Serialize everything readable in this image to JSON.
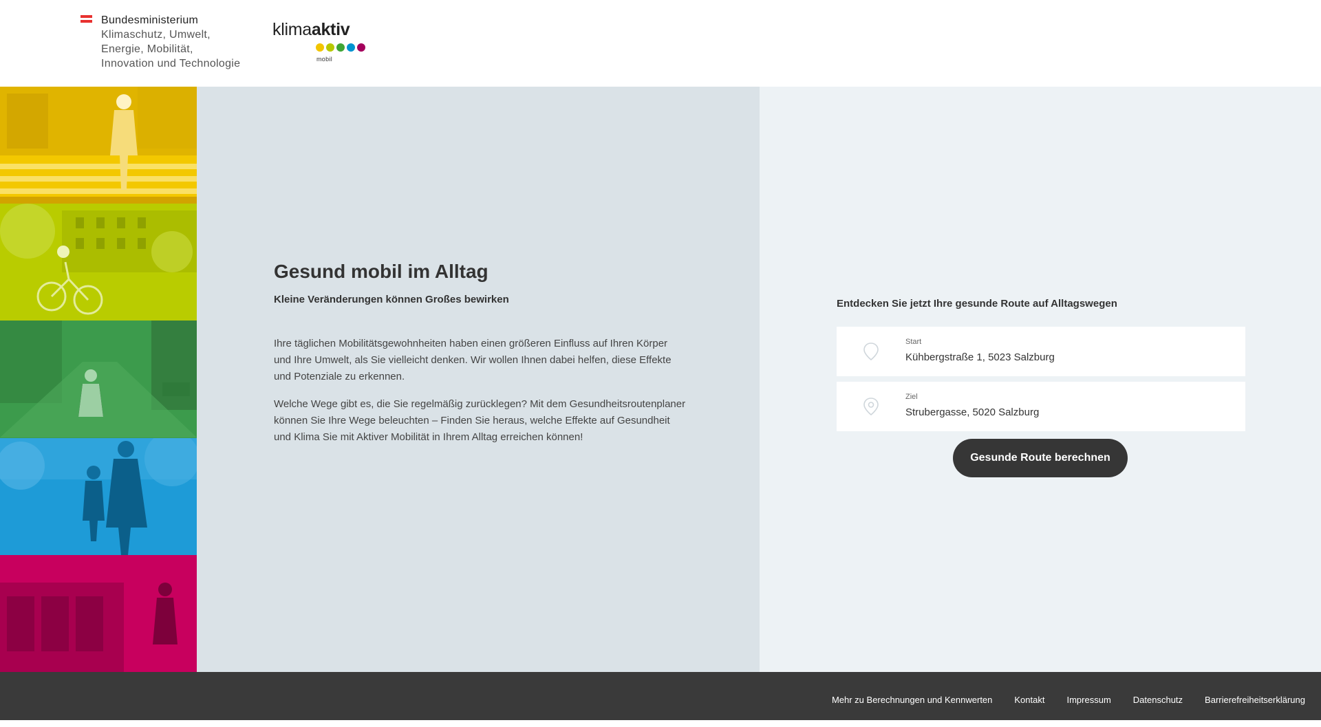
{
  "header": {
    "ministry_lines": [
      "Bundesministerium",
      "Klimaschutz, Umwelt,",
      "Energie, Mobilität,",
      "Innovation und Technologie"
    ],
    "klima_logo": {
      "word_regular": "klima",
      "word_bold": "aktiv",
      "sub": "mobil",
      "dot_colors": [
        "#f2c500",
        "#b7c800",
        "#3fa535",
        "#0093d0",
        "#a4005c"
      ]
    },
    "flag_colors": [
      "#e8312f",
      "#ffffff",
      "#e8312f"
    ]
  },
  "photo_strip": {
    "tiles": [
      {
        "name": "pedestrian-crossing-photo",
        "color": "#f3c800"
      },
      {
        "name": "cyclist-photo",
        "color": "#b9cc00"
      },
      {
        "name": "street-walker-photo",
        "color": "#3c9b4c"
      },
      {
        "name": "family-walking-photo",
        "color": "#1e9bd7"
      },
      {
        "name": "bus-passenger-photo",
        "color": "#c8005e"
      }
    ]
  },
  "intro": {
    "title": "Gesund mobil im Alltag",
    "subtitle": "Kleine Veränderungen können Großes bewirken",
    "paragraphs": [
      "Ihre täglichen Mobilitätsgewohnheiten haben einen größeren Einfluss auf Ihren Körper und Ihre Umwelt, als Sie vielleicht denken. Wir wollen Ihnen dabei helfen, diese Effekte und Potenziale zu erkennen.",
      "Welche Wege gibt es, die Sie regelmäßig zurücklegen? Mit dem Gesundheitsroutenplaner können Sie Ihre Wege beleuchten – Finden Sie heraus, welche Effekte auf Gesundheit und Klima Sie mit Aktiver Mobilität in Ihrem Alltag erreichen können!"
    ]
  },
  "route": {
    "heading": "Entdecken Sie jetzt Ihre gesunde Route auf Alltagswegen",
    "start": {
      "label": "Start",
      "value": "Kühbergstraße 1, 5023 Salzburg"
    },
    "destination": {
      "label": "Ziel",
      "value": "Strubergasse, 5020 Salzburg"
    },
    "button_label": "Gesunde Route berechnen"
  },
  "footer": {
    "links": [
      "Mehr zu Berechnungen und Kennwerten",
      "Kontakt",
      "Impressum",
      "Datenschutz",
      "Barrierefreiheitserklärung"
    ]
  }
}
